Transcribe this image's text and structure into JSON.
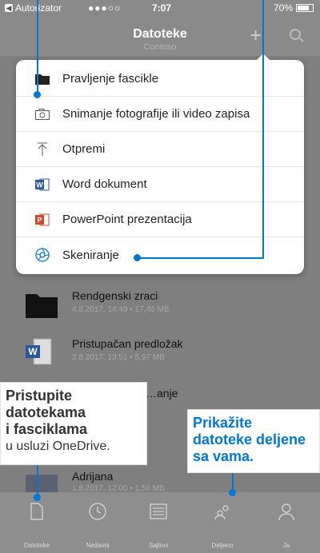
{
  "status_bar": {
    "back_label": "Autorizator",
    "signal": "●●●○○",
    "time": "7:07",
    "battery": "70%"
  },
  "nav": {
    "title": "Datoteke",
    "subtitle": "Contoso"
  },
  "menu": {
    "items": [
      {
        "label": "Pravljenje fascikle",
        "icon": "folder-icon"
      },
      {
        "label": "Snimanje fotografije ili video zapisa",
        "icon": "camera-icon"
      },
      {
        "label": "Otpremi",
        "icon": "upload-icon"
      },
      {
        "label": "Word dokument",
        "icon": "word-icon"
      },
      {
        "label": "PowerPoint prezentacija",
        "icon": "powerpoint-icon"
      },
      {
        "label": "Skeniranje",
        "icon": "scan-icon"
      }
    ]
  },
  "files": [
    {
      "name": "Rendgenski zraci",
      "meta": "4.8.2017. 14:49 • 17,48 MB",
      "icon": "folder-icon"
    },
    {
      "name": "Pristupačan predložak",
      "meta": "2.8.2017. 13:51 • 5,97 MB",
      "icon": "word-icon"
    },
    {
      "name": "…anje",
      "meta": "",
      "icon": ""
    },
    {
      "name": "Adrijana",
      "meta": "1.8.2017. 12:00 • 1,56 MB",
      "icon": "image-thumb"
    }
  ],
  "tabs": [
    {
      "label": "Datoteke",
      "icon": "files-icon"
    },
    {
      "label": "Nedavni",
      "icon": "clock-icon"
    },
    {
      "label": "Sajtovi",
      "icon": "sites-icon"
    },
    {
      "label": "Deljeno",
      "icon": "shared-icon"
    },
    {
      "label": "Ja",
      "icon": "person-icon"
    }
  ],
  "callouts": {
    "left": {
      "line1": "Pristupite",
      "line2": "datotekama",
      "line3": "i fasciklama",
      "line4": "u usluzi OneDrive."
    },
    "right": {
      "line1": "Prikažite",
      "line2": "datoteke deljene",
      "line3": "sa vama."
    }
  },
  "colors": {
    "accent": "#0078d4",
    "word": "#2b579a",
    "powerpoint": "#d24726"
  }
}
